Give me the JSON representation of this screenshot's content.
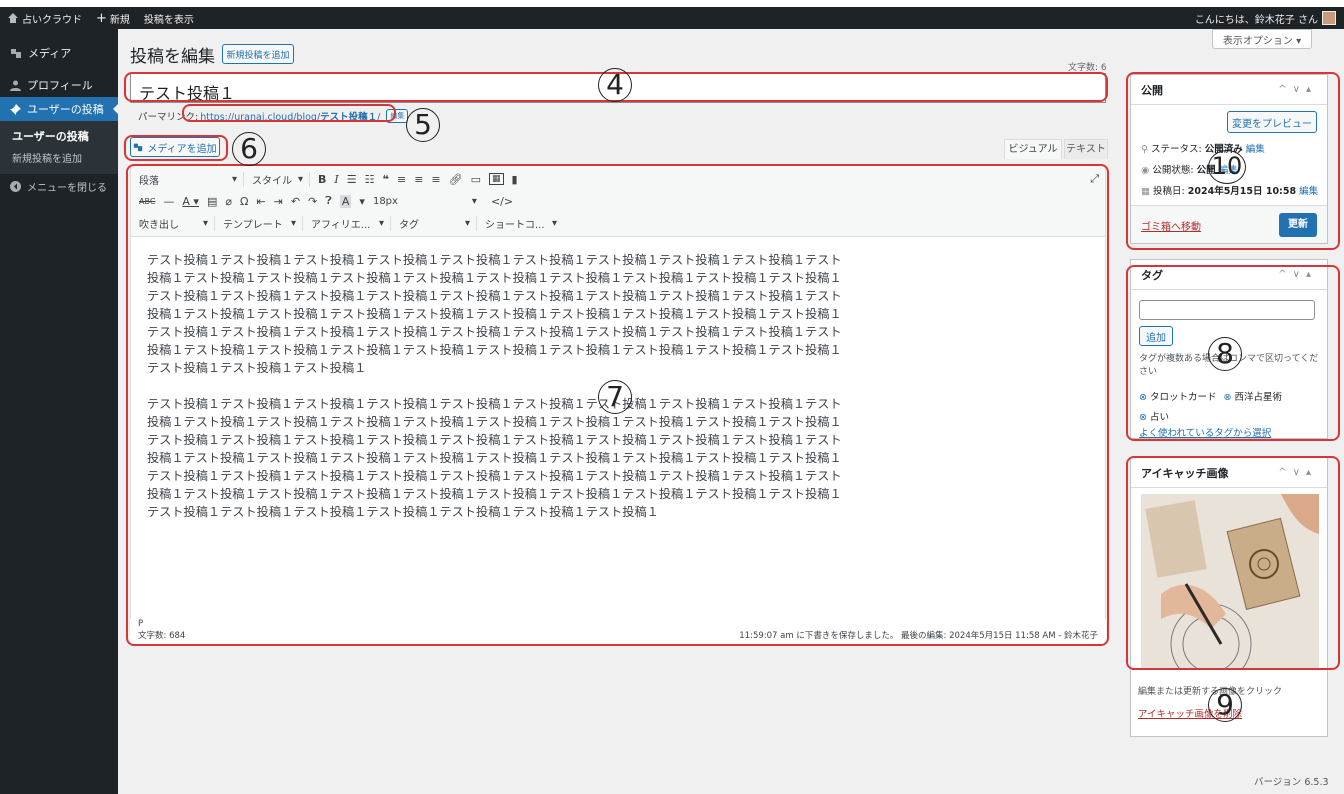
{
  "adminbar": {
    "site": "占いクラウド",
    "new": "新規",
    "view": "投稿を表示",
    "greeting": "こんにちは、鈴木花子 さん"
  },
  "sidebar": {
    "items": [
      {
        "label": "メディア",
        "icon": "media-icon"
      },
      {
        "label": "プロフィール",
        "icon": "user-icon"
      },
      {
        "label": "ユーザーの投稿",
        "icon": "pin-icon"
      }
    ],
    "sub": [
      "ユーザーの投稿",
      "新規投稿を追加"
    ],
    "collapse": "メニューを閉じる"
  },
  "page": {
    "title": "投稿を編集",
    "add_new": "新規投稿を追加",
    "screen_options": "表示オプション ▾",
    "char_count": "文字数: 6"
  },
  "post": {
    "title": "テスト投稿１",
    "permalink_label": "パーマリンク:",
    "permalink_url": "https://uranai.cloud/blog/",
    "permalink_slug": "テスト投稿１",
    "permalink_end": "/",
    "permalink_edit": "編集"
  },
  "editor": {
    "add_media": "メディアを追加",
    "tab_visual": "ビジュアル",
    "tab_text": "テキスト",
    "format": "段落",
    "style": "スタイル",
    "fontsize": "18px",
    "row3": [
      "吹き出し",
      "テンプレート",
      "アフィリエ...",
      "タグ",
      "ショートコ..."
    ],
    "para1": "テスト投稿１テスト投稿１テスト投稿１テスト投稿１テスト投稿１テスト投稿１テスト投稿１テスト投稿１テスト投稿１テスト投稿１テスト投稿１テスト投稿１テスト投稿１テスト投稿１テスト投稿１テスト投稿１テスト投稿１テスト投稿１テスト投稿１テスト投稿１テスト投稿１テスト投稿１テスト投稿１テスト投稿１テスト投稿１テスト投稿１テスト投稿１テスト投稿１テスト投稿１テスト投稿１テスト投稿１テスト投稿１テスト投稿１テスト投稿１テスト投稿１テスト投稿１テスト投稿１テスト投稿１テスト投稿１テスト投稿１テスト投稿１テスト投稿１テスト投稿１テスト投稿１テスト投稿１テスト投稿１テスト投稿１テスト投稿１テスト投稿１テスト投稿１テスト投稿１テスト投稿１テスト投稿１テスト投稿１テスト投稿１テスト投稿１テスト投稿１テスト投稿１テスト投稿１テスト投稿１",
    "para2": "テスト投稿１テスト投稿１テスト投稿１テスト投稿１テスト投稿１テスト投稿１テスト投稿１テスト投稿１テスト投稿１テスト投稿１テスト投稿１テスト投稿１テスト投稿１テスト投稿１テスト投稿１テスト投稿１テスト投稿１テスト投稿１テスト投稿１テスト投稿１テスト投稿１テスト投稿１テスト投稿１テスト投稿１テスト投稿１テスト投稿１テスト投稿１テスト投稿１テスト投稿１テスト投稿１テスト投稿１テスト投稿１テスト投稿１テスト投稿１テスト投稿１テスト投稿１テスト投稿１テスト投稿１テスト投稿１テスト投稿１テスト投稿１テスト投稿１テスト投稿１テスト投稿１テスト投稿１テスト投稿１テスト投稿１テスト投稿１テスト投稿１テスト投稿１テスト投稿１テスト投稿１テスト投稿１テスト投稿１テスト投稿１テスト投稿１テスト投稿１テスト投稿１テスト投稿１テスト投稿１テスト投稿１テスト投稿１テスト投稿１テスト投稿１",
    "path": "P",
    "word_count": "文字数: 684",
    "status": "11:59:07 am に下書きを保存しました。 最後の編集: 2024年5月15日 11:58 AM - 鈴木花子"
  },
  "publish": {
    "title": "公開",
    "preview": "変更をプレビュー",
    "status_label": "ステータス:",
    "status_value": "公開済み",
    "visibility_label": "公開状態:",
    "visibility_value": "公開",
    "date_label": "投稿日:",
    "date_value": "2024年5月15日 10:58",
    "edit": "編集",
    "trash": "ゴミ箱へ移動",
    "update": "更新"
  },
  "tags": {
    "title": "タグ",
    "add": "追加",
    "hint": "タグが複数ある場合はコンマで区切ってください",
    "items": [
      "タロットカード",
      "西洋占星術",
      "占い"
    ],
    "choose": "よく使われているタグから選択"
  },
  "featured": {
    "title": "アイキャッチ画像",
    "hint": "編集または更新する画像をクリック",
    "remove": "アイキャッチ画像を削除"
  },
  "footer": {
    "version": "バージョン 6.5.3"
  },
  "annotations": [
    "4",
    "5",
    "6",
    "7",
    "8",
    "9",
    "10"
  ],
  "colors": {
    "accent": "#2271b1",
    "annotation": "#d63638",
    "adminbar": "#1d2327"
  }
}
